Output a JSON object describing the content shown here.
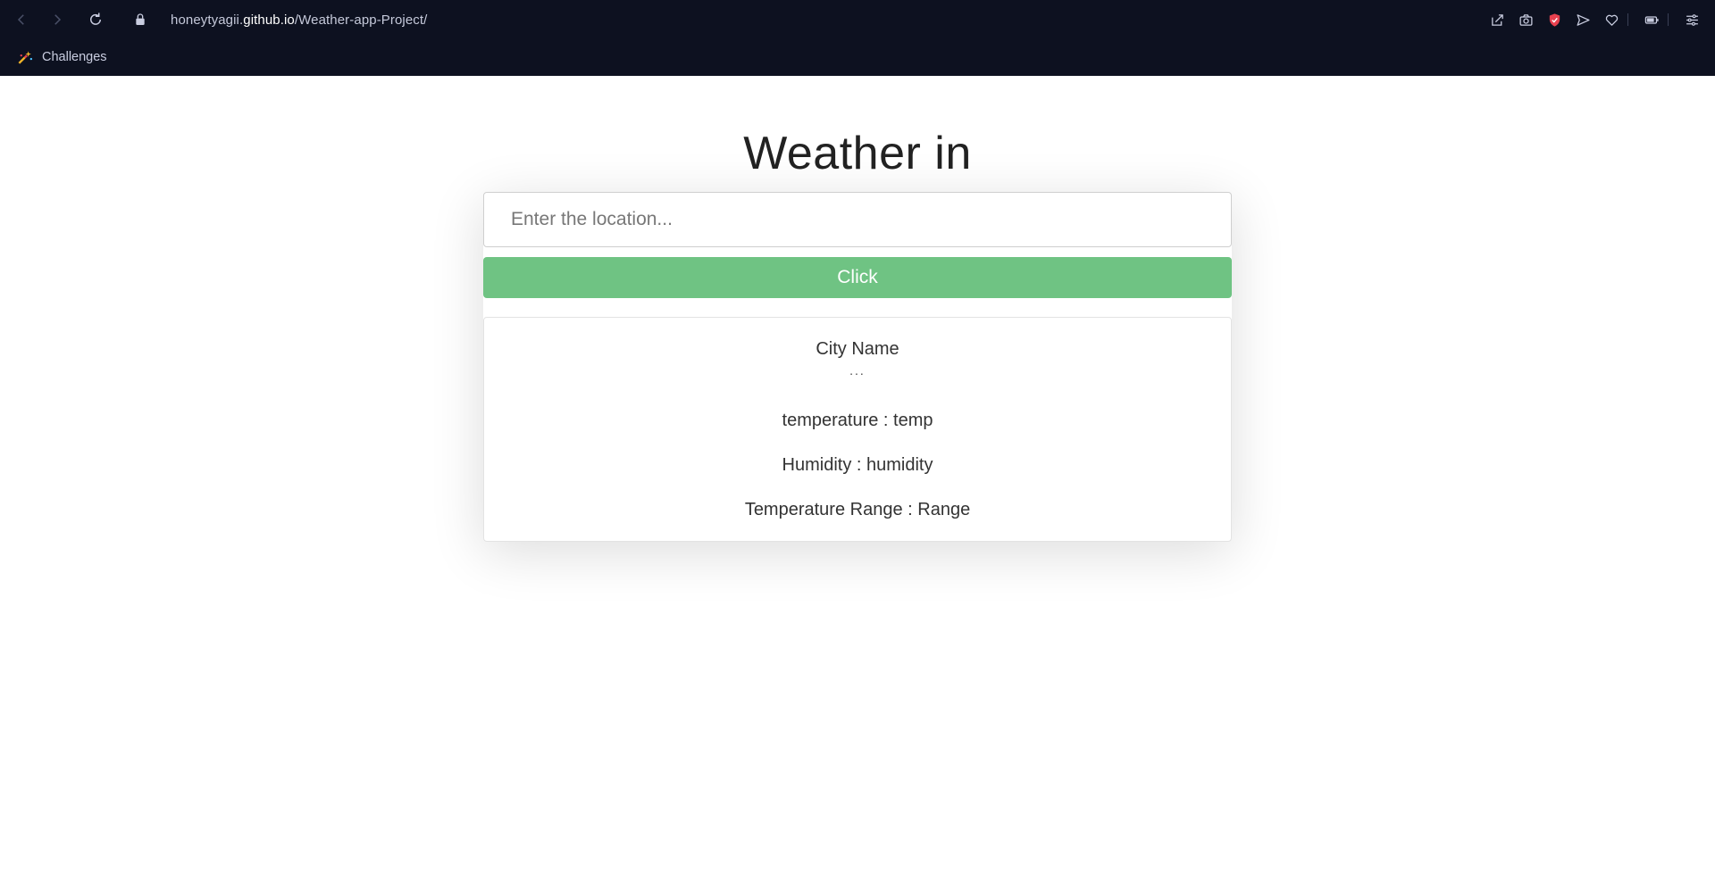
{
  "browser": {
    "url_prefix": "honeytyagii.",
    "url_host": "github.io",
    "url_path": "/Weather-app-Project/",
    "bookmark_label": "Challenges"
  },
  "page": {
    "title": "Weather in",
    "search_placeholder": "Enter the location...",
    "button_label": "Click",
    "city_name": "City Name",
    "dots": "...",
    "temperature": "temperature : temp",
    "humidity": "Humidity : humidity",
    "temperature_range": "Temperature Range : Range"
  },
  "colors": {
    "chrome_bg": "#0d1120",
    "button_bg": "#6fc383"
  }
}
